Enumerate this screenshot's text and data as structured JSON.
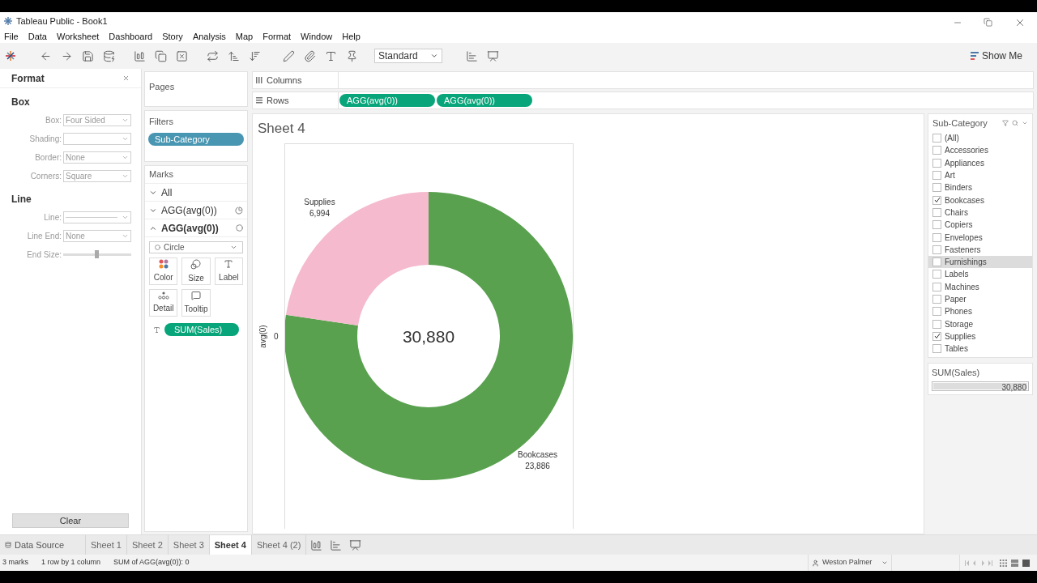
{
  "window": {
    "title": "Tableau Public - Book1"
  },
  "menu": [
    "File",
    "Data",
    "Worksheet",
    "Dashboard",
    "Story",
    "Analysis",
    "Map",
    "Format",
    "Window",
    "Help"
  ],
  "toolbar": {
    "fit_dropdown": "Standard",
    "show_me": "Show Me"
  },
  "format_panel": {
    "title": "Format",
    "sections": [
      {
        "heading": "Box",
        "fields": [
          {
            "label": "Box:",
            "kind": "dropdown",
            "value": "Four Sided"
          },
          {
            "label": "Shading:",
            "kind": "dropdown"
          },
          {
            "label": "Border:",
            "kind": "dropdown",
            "value": "None"
          },
          {
            "label": "Corners:",
            "kind": "dropdown",
            "value": "Square"
          }
        ]
      },
      {
        "heading": "Line",
        "fields": [
          {
            "label": "Line:",
            "kind": "line"
          },
          {
            "label": "Line End:",
            "kind": "dropdown",
            "value": "None"
          },
          {
            "label": "End Size:",
            "kind": "slider",
            "level": 0.5
          }
        ]
      }
    ],
    "clear_button": "Clear"
  },
  "pages": {
    "title": "Pages"
  },
  "filters": {
    "title": "Filters",
    "pills": [
      "Sub-Category"
    ]
  },
  "marks": {
    "title": "Marks",
    "cards": [
      {
        "label": "All",
        "expanded": false,
        "kind": "all"
      },
      {
        "label": "AGG(avg(0))",
        "expanded": false,
        "kind": "pie"
      },
      {
        "label": "AGG(avg(0))",
        "expanded": true,
        "kind": "circle"
      }
    ],
    "mark_type": "Circle",
    "buttons": [
      {
        "label": "Color",
        "kind": "color"
      },
      {
        "label": "Size",
        "kind": "size"
      },
      {
        "label": "Label",
        "kind": "label"
      },
      {
        "label": "Detail",
        "kind": "detail"
      },
      {
        "label": "Tooltip",
        "kind": "tooltip"
      }
    ],
    "pills": [
      "SUM(Sales)"
    ]
  },
  "shelves": [
    {
      "label": "Columns"
    },
    {
      "label": "Rows",
      "pills": [
        "AGG(avg(0))",
        "AGG(avg(0))"
      ]
    }
  ],
  "sheet": {
    "title": "Sheet 4",
    "axis_tick": "0",
    "chart_data": {
      "type": "donut",
      "ylabel": "avg(0)",
      "categories": [
        "Bookcases",
        "Supplies"
      ],
      "values": [
        23886,
        6994
      ],
      "colors": [
        "#59a14f",
        "#f5bacd"
      ],
      "value_labels": [
        "23,886",
        "6,994"
      ],
      "annotations": [
        {
          "text": "30,880"
        }
      ]
    }
  },
  "legend": {
    "filter": {
      "title": "Sub-Category",
      "items": [
        {
          "label": "(All)",
          "checked": false,
          "highlighted": false
        },
        {
          "label": "Accessories",
          "checked": false,
          "highlighted": false
        },
        {
          "label": "Appliances",
          "checked": false,
          "highlighted": false
        },
        {
          "label": "Art",
          "checked": false,
          "highlighted": false
        },
        {
          "label": "Binders",
          "checked": false,
          "highlighted": false
        },
        {
          "label": "Bookcases",
          "checked": true,
          "highlighted": false
        },
        {
          "label": "Chairs",
          "checked": false,
          "highlighted": false
        },
        {
          "label": "Copiers",
          "checked": false,
          "highlighted": false
        },
        {
          "label": "Envelopes",
          "checked": false,
          "highlighted": false
        },
        {
          "label": "Fasteners",
          "checked": false,
          "highlighted": false
        },
        {
          "label": "Furnishings",
          "checked": false,
          "highlighted": true
        },
        {
          "label": "Labels",
          "checked": false,
          "highlighted": false
        },
        {
          "label": "Machines",
          "checked": false,
          "highlighted": false
        },
        {
          "label": "Paper",
          "checked": false,
          "highlighted": false
        },
        {
          "label": "Phones",
          "checked": false,
          "highlighted": false
        },
        {
          "label": "Storage",
          "checked": false,
          "highlighted": false
        },
        {
          "label": "Supplies",
          "checked": true,
          "highlighted": false
        },
        {
          "label": "Tables",
          "checked": false,
          "highlighted": false
        }
      ]
    },
    "size": {
      "title": "SUM(Sales)",
      "value": "30,880",
      "level": 1
    }
  },
  "tabs": {
    "data_source": "Data Source",
    "sheets": [
      {
        "label": "Sheet 1",
        "selected": false
      },
      {
        "label": "Sheet 2",
        "selected": false
      },
      {
        "label": "Sheet 3",
        "selected": false
      },
      {
        "label": "Sheet 4",
        "selected": true
      },
      {
        "label": "Sheet 4 (2)",
        "selected": false
      }
    ]
  },
  "status": {
    "items": [
      "3 marks",
      "1 row by 1 column",
      "SUM of AGG(avg(0)): 0"
    ],
    "user": "Weston Palmer"
  }
}
